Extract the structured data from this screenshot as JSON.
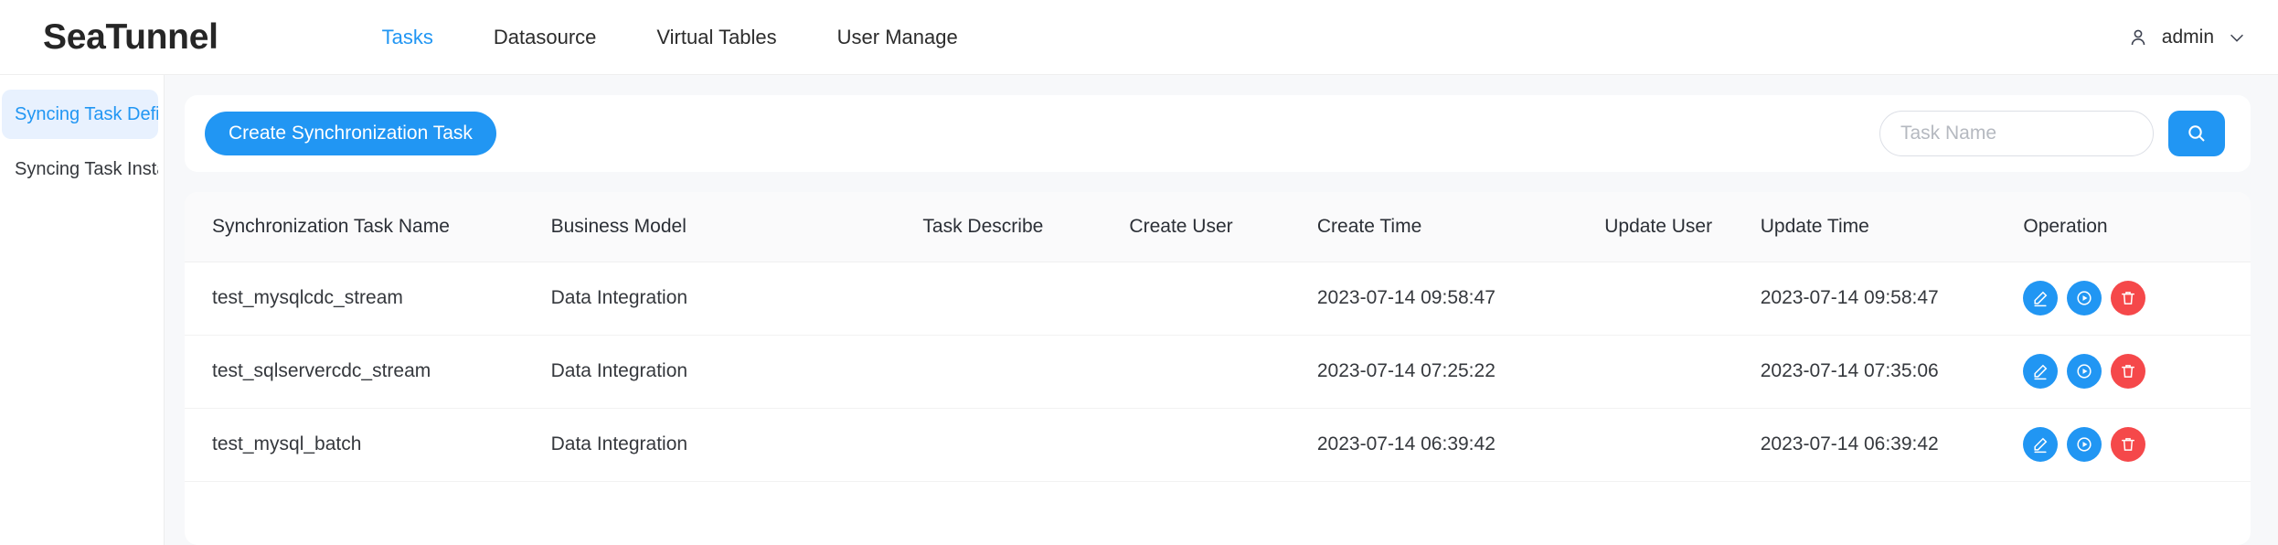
{
  "header": {
    "logo": "SeaTunnel",
    "nav": [
      {
        "label": "Tasks",
        "active": true
      },
      {
        "label": "Datasource",
        "active": false
      },
      {
        "label": "Virtual Tables",
        "active": false
      },
      {
        "label": "User Manage",
        "active": false
      }
    ],
    "user": {
      "name": "admin",
      "avatar_icon": "user-icon",
      "chevron_icon": "chevron-down-icon"
    }
  },
  "sidebar": {
    "items": [
      {
        "label": "Syncing Task Definit...",
        "active": true
      },
      {
        "label": "Syncing Task Instance",
        "active": false
      }
    ]
  },
  "toolbar": {
    "create_label": "Create Synchronization Task",
    "search_placeholder": "Task Name",
    "search_value": "",
    "search_icon": "search-icon"
  },
  "table": {
    "columns": [
      "Synchronization Task Name",
      "Business Model",
      "Task Describe",
      "Create User",
      "Create Time",
      "Update User",
      "Update Time",
      "Operation"
    ],
    "rows": [
      {
        "name": "test_mysqlcdc_stream",
        "model": "Data Integration",
        "describe": "",
        "create_user": "",
        "create_time": "2023-07-14 09:58:47",
        "update_user": "",
        "update_time": "2023-07-14 09:58:47"
      },
      {
        "name": "test_sqlservercdc_stream",
        "model": "Data Integration",
        "describe": "",
        "create_user": "",
        "create_time": "2023-07-14 07:25:22",
        "update_user": "",
        "update_time": "2023-07-14 07:35:06"
      },
      {
        "name": "test_mysql_batch",
        "model": "Data Integration",
        "describe": "",
        "create_user": "",
        "create_time": "2023-07-14 06:39:42",
        "update_user": "",
        "update_time": "2023-07-14 06:39:42"
      }
    ],
    "operations": {
      "edit_icon": "edit-pencil-icon",
      "run_icon": "play-circle-icon",
      "delete_icon": "trash-icon"
    }
  },
  "colors": {
    "accent": "#2196f3",
    "danger": "#f5484a",
    "sidebar_active_bg": "#e8f1fe",
    "content_bg": "#f7f8fa"
  }
}
